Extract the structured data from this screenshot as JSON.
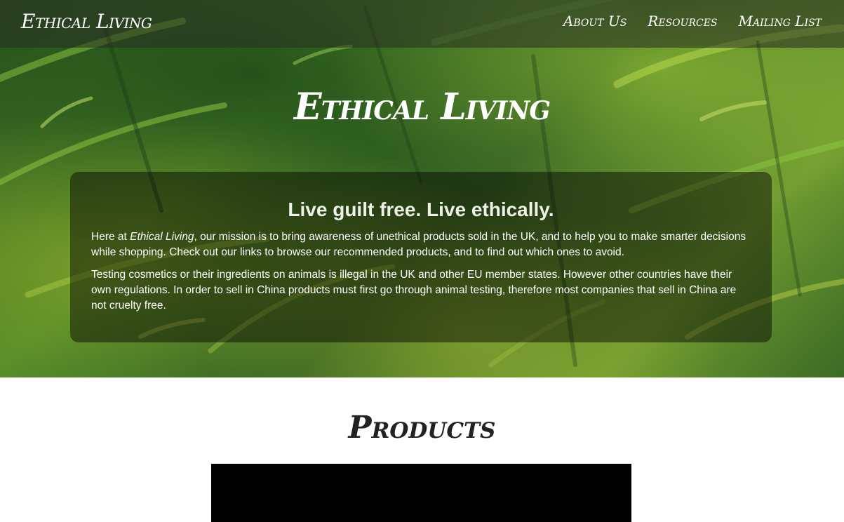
{
  "navbar": {
    "brand": "Ethical Living",
    "links": [
      "About Us",
      "Resources",
      "Mailing List"
    ]
  },
  "hero": {
    "title": "Ethical Living",
    "tagline": "Live guilt free. Live ethically.",
    "intro": {
      "prefix": "Here at ",
      "emphasis": "Ethical Living",
      "suffix": ", our mission is to bring awareness of unethical products sold in the UK, and to help you to make smarter decisions while shopping. Check out our links to browse our recommended products, and to find out which ones to avoid."
    },
    "paragraph2": "Testing cosmetics or their ingredients on animals is illegal in the UK and other EU member states. However other countries have their own regulations. In order to sell in China products must first go through animal testing, therefore most companies that sell in China are not cruelty free."
  },
  "products": {
    "heading": "Products"
  },
  "colors": {
    "navbar_bg": "#282d23",
    "panel_bg": "#000000",
    "text_light": "#ffffff",
    "heading_dark": "#222222",
    "video_bg": "#000000"
  }
}
